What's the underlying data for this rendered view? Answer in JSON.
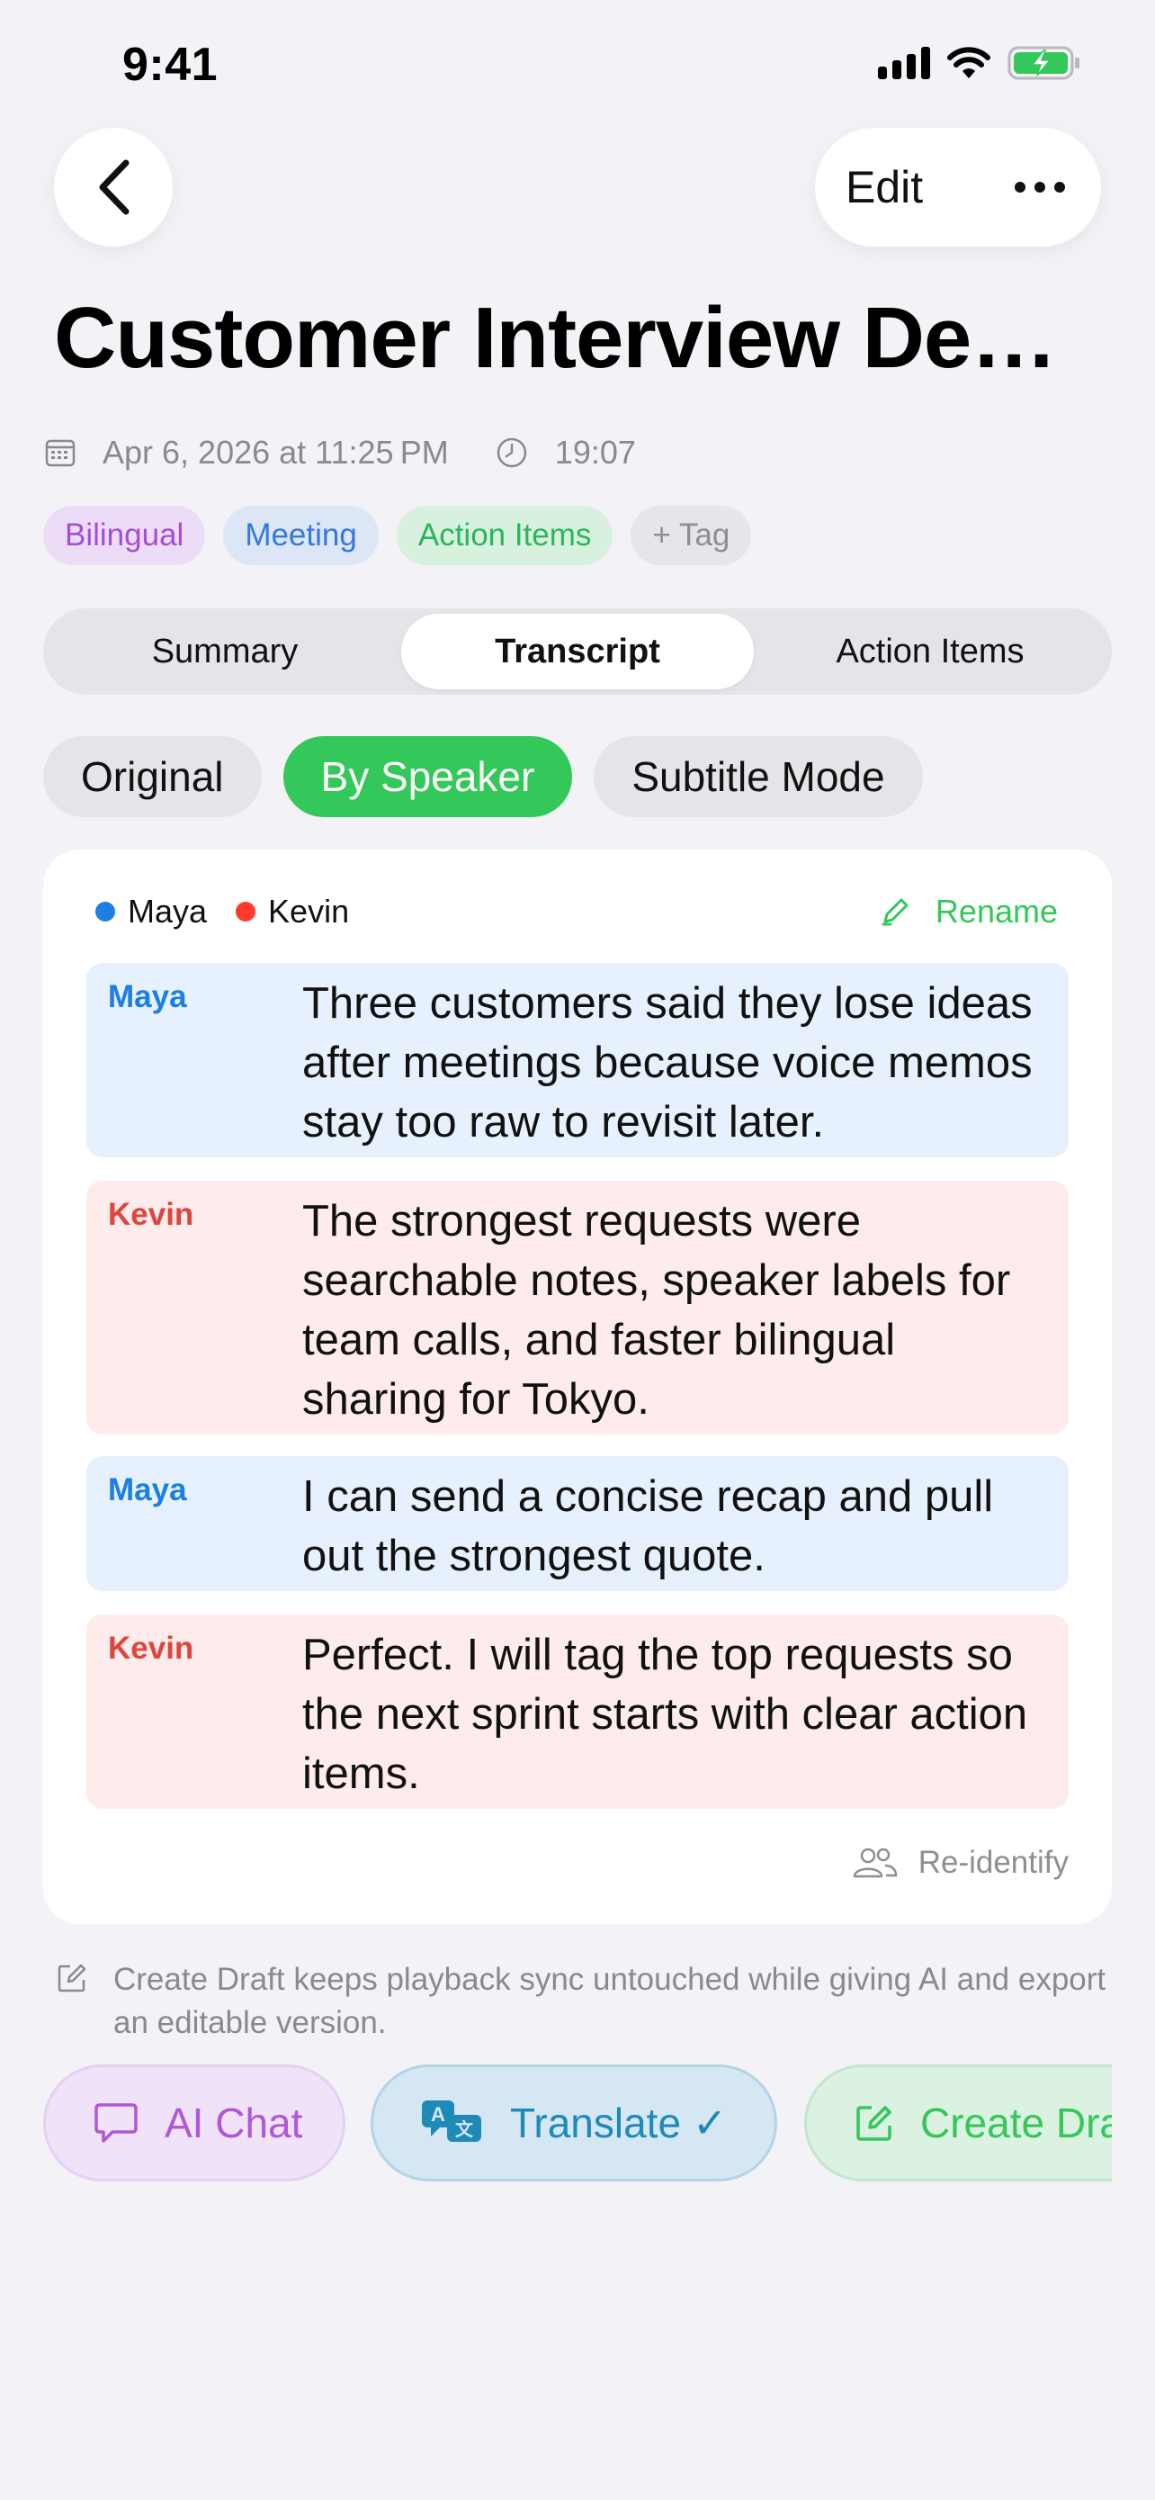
{
  "status_bar": {
    "time": "9:41"
  },
  "nav": {
    "edit_label": "Edit"
  },
  "title": "Customer Interview De…",
  "meta": {
    "date": "Apr 6, 2026 at 11:25 PM",
    "duration": "19:07"
  },
  "tags": [
    {
      "label": "Bilingual"
    },
    {
      "label": "Meeting"
    },
    {
      "label": "Action Items"
    },
    {
      "label": "+ Tag"
    }
  ],
  "tabs": [
    {
      "label": "Summary",
      "active": false
    },
    {
      "label": "Transcript",
      "active": true
    },
    {
      "label": "Action Items",
      "active": false
    }
  ],
  "modes": [
    {
      "label": "Original",
      "active": false
    },
    {
      "label": "By Speaker",
      "active": true
    },
    {
      "label": "Subtitle Mode",
      "active": false
    }
  ],
  "transcript": {
    "speakers": [
      {
        "name": "Maya",
        "color": "#1b7fe3"
      },
      {
        "name": "Kevin",
        "color": "#ff3b30"
      }
    ],
    "rename_label": "Rename",
    "segments": [
      {
        "speaker": "Maya",
        "text": "Three customers said they lose ideas after meetings because voice memos stay too raw to revisit later."
      },
      {
        "speaker": "Kevin",
        "text": "The strongest requests were searchable notes, speaker labels for team calls, and faster bilingual sharing for Tokyo."
      },
      {
        "speaker": "Maya",
        "text": "I can send a concise recap and pull out the strongest quote."
      },
      {
        "speaker": "Kevin",
        "text": "Perfect. I will tag the top requests so the next sprint starts with clear action items."
      }
    ],
    "reidentify_label": "Re-identify"
  },
  "footnote": "Create Draft keeps playback sync untouched while giving AI and export an editable version.",
  "actions": [
    {
      "label": "AI Chat",
      "icon": "chat-bubble-icon"
    },
    {
      "label": "Translate ✓",
      "icon": "translate-icon"
    },
    {
      "label": "Create Draft",
      "icon": "edit-square-icon"
    }
  ],
  "colors": {
    "accent_green": "#34c759",
    "background": "#f2f2f7",
    "maya_bg": "#e7f1fd",
    "kevin_bg": "#fdeceb"
  }
}
